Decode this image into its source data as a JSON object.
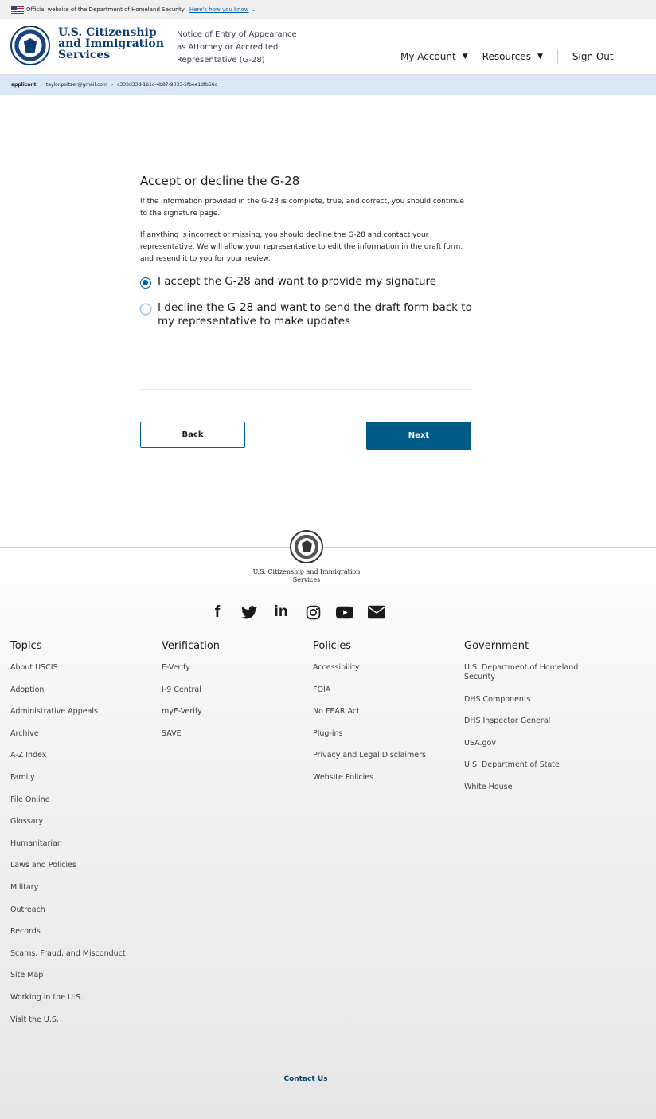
{
  "gov_banner": {
    "text": "Official website of the Department of Homeland Security",
    "how_link": "Here's how you know",
    "chevron": "⌄"
  },
  "header": {
    "logo_lines": [
      "U.S. Citizenship",
      "and Immigration",
      "Services"
    ],
    "form_title": "Notice of Entry of Appearance as Attorney or Accredited Representative (G-28)",
    "nav": {
      "my_account": "My Account",
      "resources": "Resources",
      "sign_out": "Sign Out"
    }
  },
  "breadcrumb": {
    "role": "applicant",
    "email": "taylor.poltzer@gmail.com",
    "id": "c333d33d-1b1c-4b87-9033-5fbee1dfb56c"
  },
  "main": {
    "title": "Accept or decline the G-28",
    "para1": "If the information provided in the G-28 is complete, true, and correct, you should continue to the signature page.",
    "para2": "If anything is incorrect or missing, you should decline the G-28 and contact your representative. We will allow your representative to edit the information in the draft form, and resend it to you for your review.",
    "options": [
      {
        "label": "I accept the G-28 and want to provide my signature",
        "checked": true
      },
      {
        "label": "I decline the G-28 and want to send the draft form back to my representative to make updates",
        "checked": false
      }
    ],
    "back_label": "Back",
    "next_label": "Next"
  },
  "footer": {
    "agency": "U.S. Citizenship and Immigration Services",
    "social": [
      "facebook-icon",
      "twitter-icon",
      "linkedin-icon",
      "instagram-icon",
      "youtube-icon",
      "email-icon"
    ],
    "columns": [
      {
        "title": "Topics",
        "links": [
          "About USCIS",
          "Adoption",
          "Administrative Appeals",
          "Archive",
          "A-Z Index",
          "Family",
          "File Online",
          "Glossary",
          "Humanitarian",
          "Laws and Policies",
          "Military",
          "Outreach",
          "Records",
          "Scams, Fraud, and Misconduct",
          "Site Map",
          "Working in the U.S.",
          "Visit the U.S."
        ]
      },
      {
        "title": "Verification",
        "links": [
          "E-Verify",
          "I-9 Central",
          "myE-Verify",
          "SAVE"
        ]
      },
      {
        "title": "Policies",
        "links": [
          "Accessibility",
          "FOIA",
          "No FEAR Act",
          "Plug-ins",
          "Privacy and Legal Disclaimers",
          "Website Policies"
        ]
      },
      {
        "title": "Government",
        "links": [
          "U.S. Department of Homeland Security",
          "DHS Components",
          "DHS Inspector General",
          "USA.gov",
          "U.S. Department of State",
          "White House"
        ]
      }
    ],
    "contact": "Contact Us"
  },
  "colors": {
    "primary": "#005ea2",
    "next_button": "#005b87",
    "breadcrumb_bg": "#d9e8f6",
    "logo_text": "#0b3c70"
  }
}
